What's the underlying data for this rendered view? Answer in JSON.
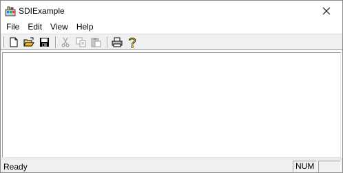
{
  "window": {
    "title": "SDIExample",
    "app_icon": "mfc-app-icon",
    "close_icon": "close-icon"
  },
  "menu": {
    "items": [
      {
        "label": "File"
      },
      {
        "label": "Edit"
      },
      {
        "label": "View"
      },
      {
        "label": "Help"
      }
    ]
  },
  "toolbar": {
    "buttons": [
      {
        "icon": "new-document-icon",
        "enabled": true
      },
      {
        "icon": "open-folder-icon",
        "enabled": true
      },
      {
        "icon": "save-icon",
        "enabled": true
      },
      {
        "icon": "cut-icon",
        "enabled": false
      },
      {
        "icon": "copy-icon",
        "enabled": false
      },
      {
        "icon": "paste-icon",
        "enabled": false
      },
      {
        "icon": "print-icon",
        "enabled": true
      },
      {
        "icon": "help-icon",
        "enabled": true
      }
    ]
  },
  "status": {
    "text": "Ready",
    "num_indicator": "NUM",
    "scroll_indicator": ""
  },
  "colors": {
    "chrome": "#f0f0f0",
    "client": "#ffffff",
    "disabled_icon": "#a0a0a0"
  }
}
